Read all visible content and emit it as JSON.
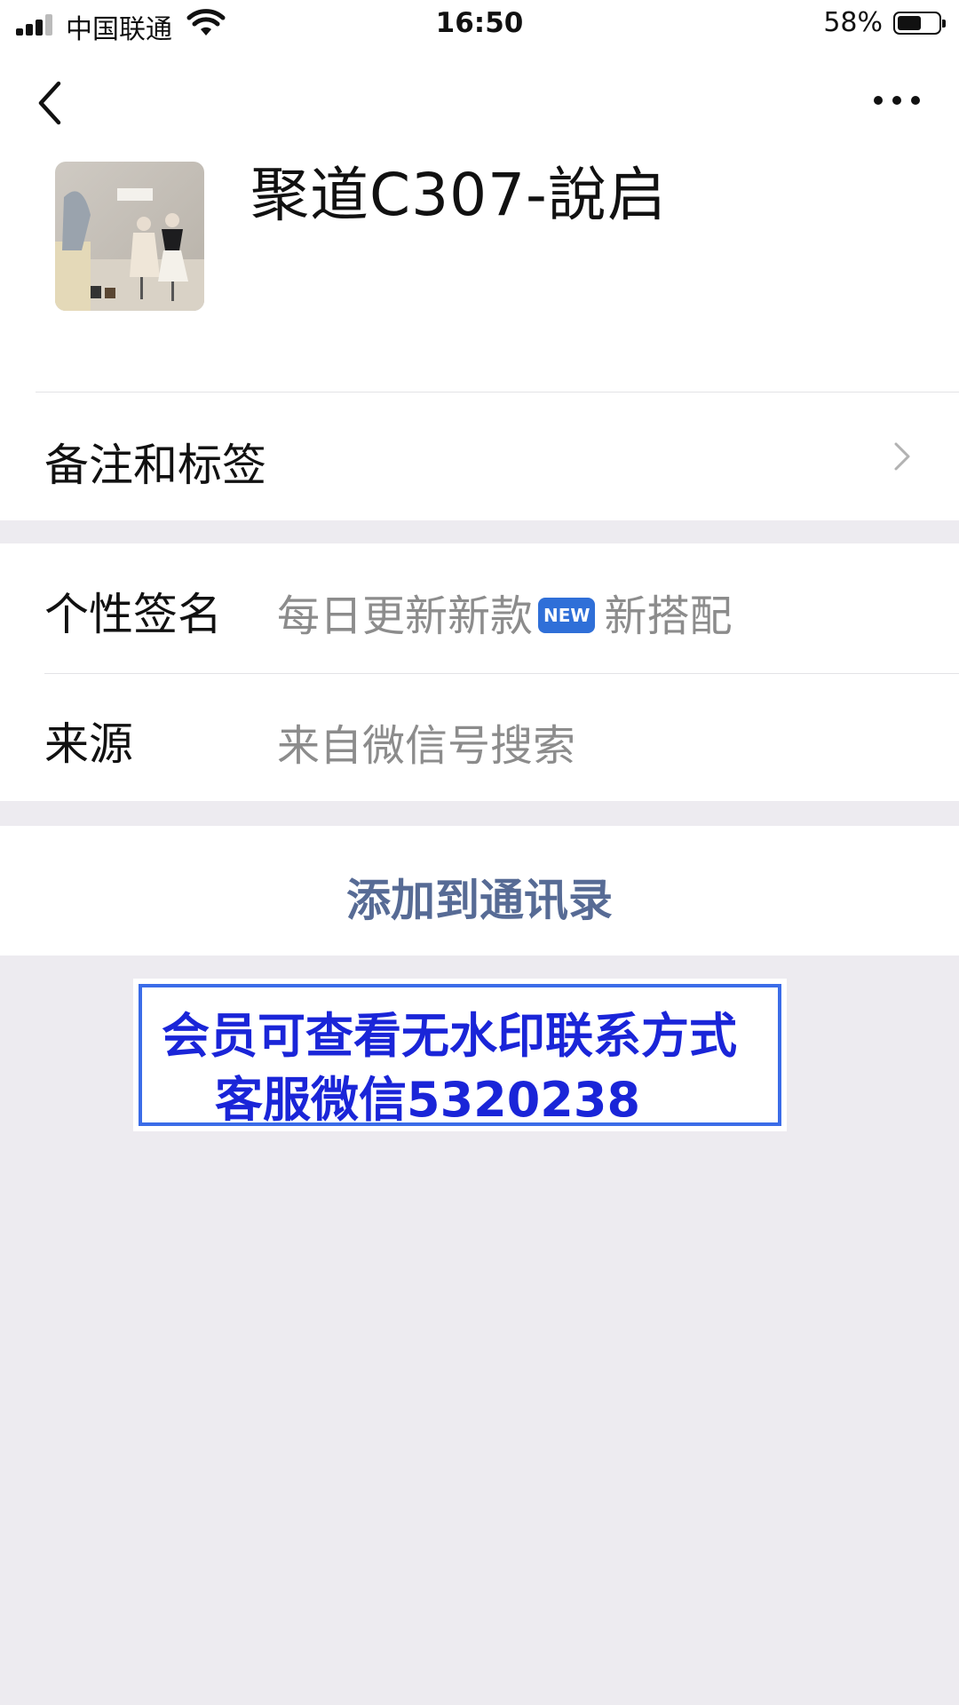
{
  "status_bar": {
    "carrier": "中国联通",
    "time": "16:50",
    "battery_percent": "58%"
  },
  "profile": {
    "name": "聚道C307-說启"
  },
  "rows": {
    "remarks_label": "备注和标签",
    "signature_label": "个性签名",
    "signature_text_before": "每日更新新款",
    "signature_badge": "NEW",
    "signature_text_after": "新搭配",
    "source_label": "来源",
    "source_value": "来自微信号搜索"
  },
  "actions": {
    "add_contact": "添加到通讯录"
  },
  "watermark": {
    "line1": "会员可查看无水印联系方式",
    "line2": "客服微信5320238"
  },
  "colors": {
    "link": "#576B95",
    "watermark_text": "#1A25D8",
    "badge": "#2F6FD8"
  }
}
